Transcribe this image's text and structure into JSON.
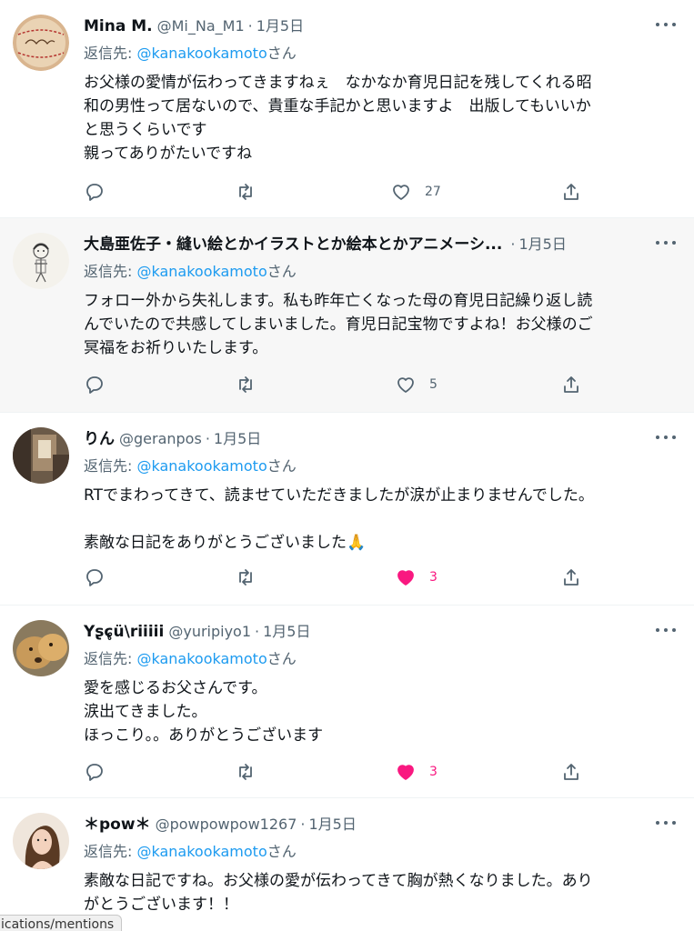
{
  "reply_prefix": "返信先:",
  "reply_suffix": "さん",
  "tweets": [
    {
      "name": "Mina M.",
      "handle": "@Mi_Na_M1",
      "date": "1月5日",
      "mention": "@kanakookamoto",
      "lines": [
        "お父様の愛情が伝わってきますねぇ　なかなか育児日記を残してくれる昭",
        "和の男性って居ないので、貴重な手記かと思いますよ　出版してもいいか",
        "と思うくらいです",
        "親ってありがたいですね"
      ],
      "likes": "27",
      "liked": false
    },
    {
      "name": "大島亜佐子・縫い絵とかイラストとか絵本とかアニメーシ...",
      "handle": "",
      "date": "1月5日",
      "mention": "@kanakookamoto",
      "lines": [
        "フォロー外から失礼します。私も昨年亡くなった母の育児日記繰り返し読",
        "んでいたので共感してしまいました。育児日記宝物ですよね！お父様のご",
        "冥福をお祈りいたします。"
      ],
      "likes": "5",
      "liked": false
    },
    {
      "name": "りん",
      "handle": "@geranpos",
      "date": "1月5日",
      "mention": "@kanakookamoto",
      "lines": [
        "RTでまわってきて、読ませていただきましたが涙が止まりませんでした。",
        "",
        "素敵な日記をありがとうございました🙏"
      ],
      "likes": "3",
      "liked": true
    },
    {
      "name": "Yʂɕ̥ü\\riiiii",
      "handle": "@yuripiyo1",
      "date": "1月5日",
      "mention": "@kanakookamoto",
      "lines": [
        "愛を感じるお父さんです。",
        "涙出てきました。",
        "ほっこり。。ありがとうございます"
      ],
      "likes": "3",
      "liked": true
    },
    {
      "name": "＊pow＊",
      "handle": "@powpowpow1267",
      "date": "1月5日",
      "mention": "@kanakookamoto",
      "lines": [
        "素敵な日記ですね。お父様の愛が伝わってきて胸が熱くなりました。あり",
        "がとうございます！！"
      ],
      "likes": "",
      "liked": false
    }
  ],
  "status_url": "ications/mentions",
  "colors": {
    "text": "#0f1419",
    "muted": "#536471",
    "link": "#1d9bf0",
    "like": "#f91880",
    "highlight_bg": "#f7f7f7"
  }
}
